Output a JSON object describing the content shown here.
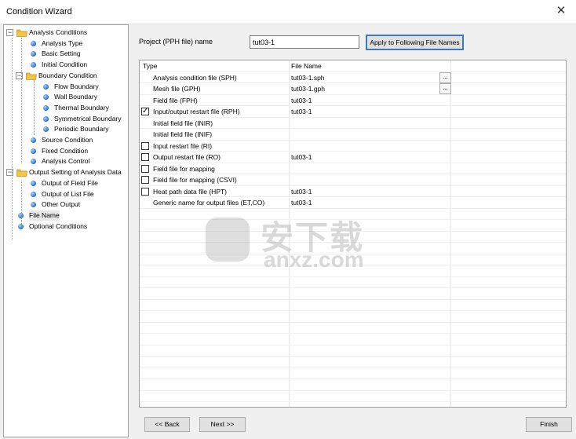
{
  "window": {
    "title": "Condition Wizard",
    "close_icon": "close-icon"
  },
  "tree": [
    {
      "label": "Analysis Conditions",
      "type": "folder",
      "expander": "⊟"
    },
    {
      "label": "Analysis Type",
      "type": "leaf"
    },
    {
      "label": "Basic Setting",
      "type": "leaf"
    },
    {
      "label": "Initial Condition",
      "type": "leaf"
    },
    {
      "label": "Boundary Condition",
      "type": "folder",
      "expander": "⊟"
    },
    {
      "label": "Flow Boundary",
      "type": "leaf"
    },
    {
      "label": "Wall Boundary",
      "type": "leaf"
    },
    {
      "label": "Thermal Boundary",
      "type": "leaf"
    },
    {
      "label": "Symmetrical Boundary",
      "type": "leaf"
    },
    {
      "label": "Periodic Boundary",
      "type": "leaf"
    },
    {
      "label": "Source Condition",
      "type": "leaf"
    },
    {
      "label": "Fixed Condition",
      "type": "leaf"
    },
    {
      "label": "Analysis Control",
      "type": "leaf"
    },
    {
      "label": "Output Setting of Analysis Data",
      "type": "folder",
      "expander": "⊟"
    },
    {
      "label": "Output of Field File",
      "type": "leaf"
    },
    {
      "label": "Output of List File",
      "type": "leaf"
    },
    {
      "label": "Other Output",
      "type": "leaf"
    },
    {
      "label": "File Name",
      "type": "leaf",
      "selected": true
    },
    {
      "label": "Optional Conditions",
      "type": "leaf"
    }
  ],
  "project": {
    "label": "Project (PPH file) name",
    "value": "tut03-1",
    "apply_button": "Apply to Following File Names"
  },
  "grid": {
    "headers": {
      "type": "Type",
      "file_name": "File Name"
    },
    "rows": [
      {
        "type": "Analysis condition file (SPH)",
        "file": "tut03-1.sph",
        "checkbox": false,
        "has_checkbox": false,
        "browse": true
      },
      {
        "type": "Mesh file (GPH)",
        "file": "tut03-1.gph",
        "checkbox": false,
        "has_checkbox": false,
        "browse": true
      },
      {
        "type": "Field file (FPH)",
        "file": "tut03-1",
        "checkbox": false,
        "has_checkbox": false,
        "browse": false
      },
      {
        "type": "Input/output restart file (RPH)",
        "file": "tut03-1",
        "checkbox": true,
        "has_checkbox": true,
        "browse": false
      },
      {
        "type": "Initial field file (INIR)",
        "file": "",
        "checkbox": false,
        "has_checkbox": false,
        "browse": false
      },
      {
        "type": "Initial field file (INIF)",
        "file": "",
        "checkbox": false,
        "has_checkbox": false,
        "browse": false
      },
      {
        "type": "Input restart file (RI)",
        "file": "",
        "checkbox": false,
        "has_checkbox": true,
        "browse": false
      },
      {
        "type": "Output restart file (RO)",
        "file": "tut03-1",
        "checkbox": false,
        "has_checkbox": true,
        "browse": false
      },
      {
        "type": "Field file for mapping",
        "file": "",
        "checkbox": false,
        "has_checkbox": true,
        "browse": false
      },
      {
        "type": "Field file for mapping (CSVI)",
        "file": "",
        "checkbox": false,
        "has_checkbox": true,
        "browse": false
      },
      {
        "type": "Heat path data file (HPT)",
        "file": "tut03-1",
        "checkbox": false,
        "has_checkbox": true,
        "browse": false
      },
      {
        "type": "Generic name for output files (ET,CO)",
        "file": "tut03-1",
        "checkbox": false,
        "has_checkbox": false,
        "browse": false
      }
    ],
    "browse_label": "..."
  },
  "watermark": {
    "line1": "安下载",
    "line2": "anxz.com"
  },
  "buttons": {
    "back": "<< Back",
    "next": "Next >>",
    "finish": "Finish"
  }
}
